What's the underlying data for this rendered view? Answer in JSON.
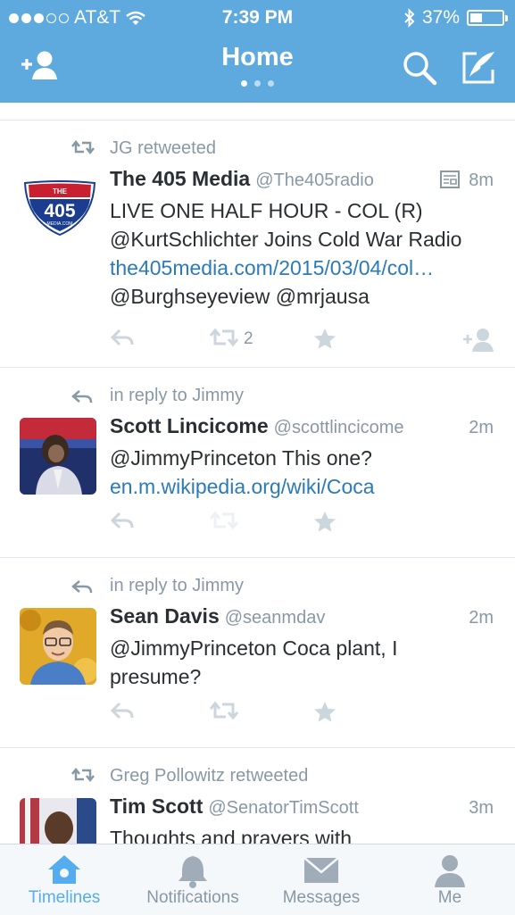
{
  "status": {
    "carrier": "AT&T",
    "time": "7:39 PM",
    "battery": "37%",
    "battery_level": 0.37
  },
  "header": {
    "title": "Home",
    "pager_index": 0,
    "pager_count": 3
  },
  "tweets": [
    {
      "context": "JG retweeted",
      "name": "The 405 Media",
      "handle": "@The405radio",
      "time": "8m",
      "avatar_text": {
        "top": "THE",
        "main": "405",
        "bottom": "MEDIA.COM"
      },
      "lines": [
        "LIVE ONE HALF HOUR - COL (R)",
        "@KurtSchlichter Joins Cold War Radio",
        "the405media.com/2015/03/04/col…",
        "@Burghseyeview @mrjausa"
      ],
      "retweet_count": "2"
    },
    {
      "context": "in reply to Jimmy",
      "name": "Scott Lincicome",
      "handle": "@scottlincicome",
      "time": "2m",
      "lines": [
        "@JimmyPrinceton This one?",
        "en.m.wikipedia.org/wiki/Coca"
      ]
    },
    {
      "context": "in reply to Jimmy",
      "name": "Sean Davis",
      "handle": "@seanmdav",
      "time": "2m",
      "lines": [
        "@JimmyPrinceton Coca plant, I",
        "presume?"
      ]
    },
    {
      "context": "Greg Pollowitz retweeted",
      "name": "Tim Scott",
      "handle": "@SenatorTimScott",
      "time": "3m",
      "lines": [
        "Thoughts and prayers with"
      ]
    }
  ],
  "tabs": [
    {
      "label": "Timelines",
      "icon": "home-icon",
      "active": true
    },
    {
      "label": "Notifications",
      "icon": "bell-icon"
    },
    {
      "label": "Messages",
      "icon": "envelope-icon"
    },
    {
      "label": "Me",
      "icon": "person-icon"
    }
  ],
  "colors": {
    "header_bg": "#5ea9dd",
    "link": "#2b7bb9",
    "muted": "#8899a6",
    "active_tab": "#55acee"
  }
}
